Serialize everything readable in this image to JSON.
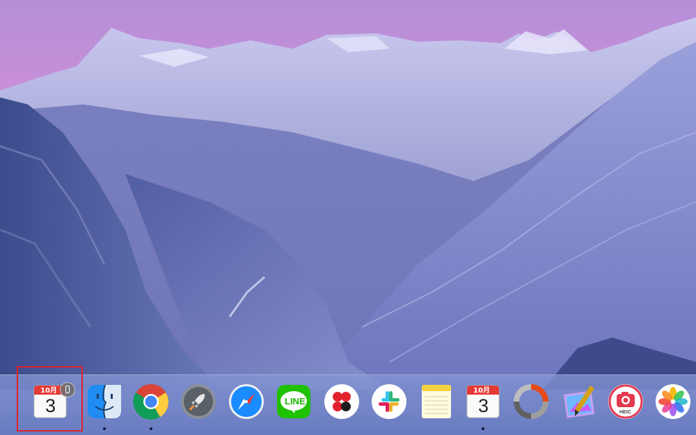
{
  "dock": {
    "handoff_calendar": {
      "name": "Calendar (Handoff from iPhone)",
      "month": "10月",
      "day": "3",
      "highlighted": true
    },
    "apps": [
      {
        "name": "Finder",
        "running": true
      },
      {
        "name": "Google Chrome",
        "running": true
      },
      {
        "name": "Launchpad",
        "running": false
      },
      {
        "name": "Safari",
        "running": false
      },
      {
        "name": "LINE",
        "running": false,
        "label": "LINE"
      },
      {
        "name": "Pinwheel app",
        "running": false
      },
      {
        "name": "Slack",
        "running": false
      },
      {
        "name": "Notes",
        "running": false
      },
      {
        "name": "Calendar",
        "running": true,
        "month": "10月",
        "day": "3"
      },
      {
        "name": "Loading app",
        "running": false
      },
      {
        "name": "Paint app",
        "running": false
      },
      {
        "name": "HEIC Converter",
        "running": false,
        "label": "HEIC"
      },
      {
        "name": "Photos",
        "running": false
      }
    ]
  },
  "colors": {
    "highlight": "#e0202a",
    "dock_background": "#7b8fd0",
    "line_green": "#1fb500",
    "finder_blue": "#1e8cf2"
  }
}
